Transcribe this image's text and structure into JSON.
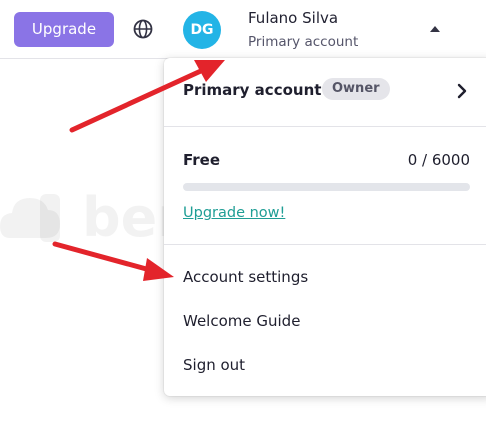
{
  "topbar": {
    "upgrade_label": "Upgrade",
    "globe_icon": "globe-icon",
    "avatar_initials": "DG",
    "user_name": "Fulano Silva",
    "user_subtitle": "Primary account",
    "caret_icon": "caret-up-icon"
  },
  "menu": {
    "account_label": "Primary account",
    "account_badge": "Owner",
    "account_chevron_icon": "chevron-right-icon",
    "plan_label": "Free",
    "usage_text": "0 / 6000",
    "usage_fraction": 0.0,
    "upgrade_link": "Upgrade now!",
    "items": [
      {
        "label": "Account settings"
      },
      {
        "label": "Welcome Guide"
      },
      {
        "label": "Sign out"
      }
    ]
  },
  "watermark": {
    "text": "bem-vindo.net"
  },
  "colors": {
    "upgrade_button": "#8a74e6",
    "avatar": "#23b4e6",
    "link_teal": "#1f9e95",
    "arrow_red": "#e3242b",
    "badge_bg": "#e5e5ea"
  }
}
